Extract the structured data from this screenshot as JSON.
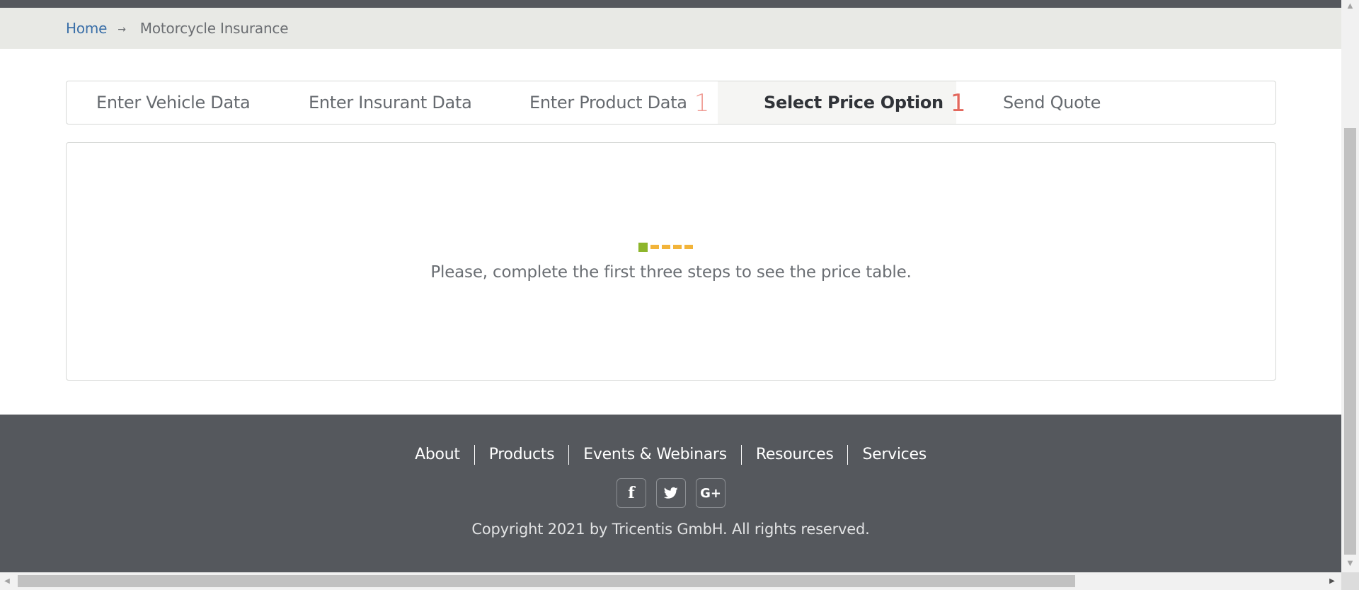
{
  "breadcrumb": {
    "home": "Home",
    "separator": "→",
    "current": "Motorcycle Insurance"
  },
  "wizard": {
    "tabs": [
      {
        "label": "Enter Vehicle Data",
        "count": ""
      },
      {
        "label": "Enter Insurant Data",
        "count": ""
      },
      {
        "label": "Enter Product Data",
        "count": "1"
      },
      {
        "label": "Select Price Option",
        "count": "1",
        "active": true
      },
      {
        "label": "Send Quote",
        "count": ""
      }
    ]
  },
  "panel": {
    "message": "Please, complete the first three steps to see the price table."
  },
  "footer": {
    "links": [
      "About",
      "Products",
      "Events & Webinars",
      "Resources",
      "Services"
    ],
    "social": [
      {
        "icon": "facebook-icon",
        "glyph": "f"
      },
      {
        "icon": "twitter-icon",
        "glyph": "🐦"
      },
      {
        "icon": "google-plus-icon",
        "glyph": "G+"
      }
    ],
    "copyright": "Copyright 2021 by Tricentis GmbH. All rights reserved."
  },
  "colors": {
    "header_dark": "#55585d",
    "breadcrumb_bg": "#e8e9e5",
    "link_blue": "#3a6fa8",
    "count_red": "#e3685d",
    "loader_green": "#8db52b",
    "loader_orange": "#f2b43a"
  }
}
